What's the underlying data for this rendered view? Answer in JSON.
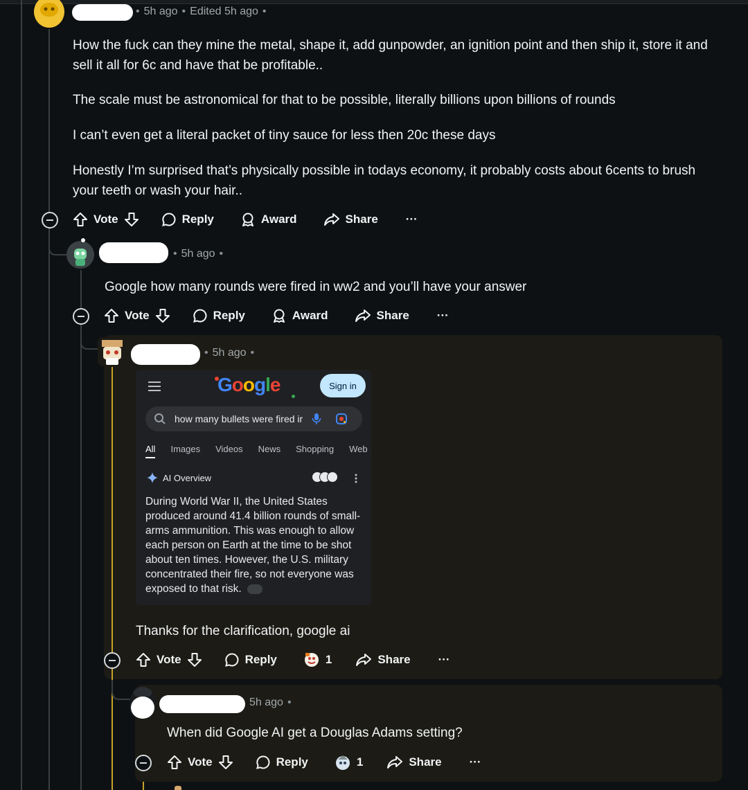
{
  "comments": [
    {
      "meta_time": "5h ago",
      "meta_edited": "Edited 5h ago",
      "paragraphs": [
        "How the fuck can they mine the metal, shape it, add gunpowder, an ignition point and then ship it, store it and sell it all for 6c and have that be profitable..",
        "The scale must be astronomical for that to be possible, literally billions upon billions of rounds",
        "I can’t even get a literal packet of tiny sauce for less then 20c these days",
        "Honestly I’m surprised that’s physically possible in todays economy, it probably costs about 6cents to brush your teeth or wash your hair.."
      ]
    },
    {
      "meta_time": "5h ago",
      "text": "Google how many rounds were fired in ww2 and you’ll have your answer"
    },
    {
      "meta_time": "5h ago",
      "text": "Thanks for the clarification, google ai",
      "award_count": "1"
    },
    {
      "meta_time": "5h ago",
      "text": "When did Google AI get a Douglas Adams setting?",
      "award_count": "1"
    }
  ],
  "actions": {
    "vote": "Vote",
    "reply": "Reply",
    "award": "Award",
    "share": "Share",
    "more": "···"
  },
  "google": {
    "logo": "Google",
    "sign_in": "Sign in",
    "query": "how many bullets were fired ir",
    "tabs": [
      "All",
      "Images",
      "Videos",
      "News",
      "Shopping",
      "Web"
    ],
    "ai_overview_label": "AI Overview",
    "ai_text": "During World War II, the United States produced around 41.4 billion rounds of small-arms ammunition. This was enough to allow each person on Earth at the time to be shot about ten times. However, the U.S. military concentrated their fire, so not everyone was exposed to that risk."
  },
  "colors": {
    "background": "#0e1113",
    "highlight": "#1c1b15",
    "thread_line": "#3a3f42",
    "gold_thread": "#c9a227",
    "google_blue": "#4285f4",
    "google_red": "#ea4335",
    "google_yellow": "#fbbc05",
    "google_green": "#34a853"
  }
}
